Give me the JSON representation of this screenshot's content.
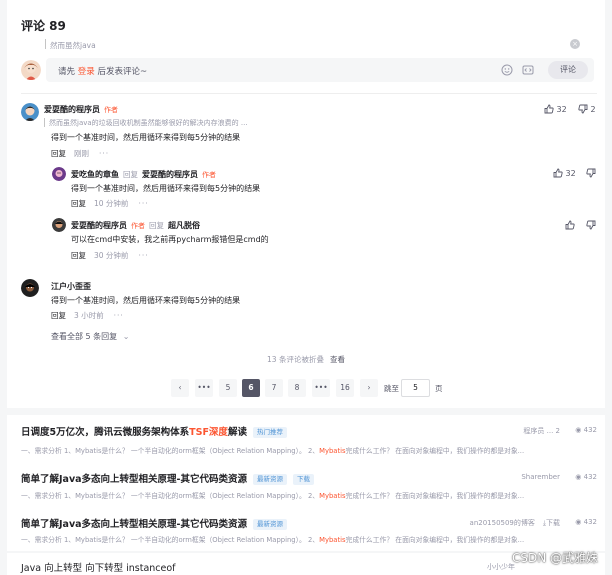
{
  "comments": {
    "title": "评论 89",
    "quote": "然而虽然java",
    "input": {
      "prefix": "请先",
      "login": "登录",
      "suffix": "后发表评论~"
    },
    "submit_label": "评论",
    "list": [
      {
        "name": "爱耍酷的程序员",
        "tag": "作者",
        "quote": "然而虽然java的垃圾回收机制虽然能够很好的解决内存浪费的 ...",
        "text": "得到一个基准时间，然后用循环来得到每5分钟的结果",
        "reply": "回复",
        "time": "刚刚",
        "more": "···",
        "likes": "32",
        "dislikes": "2"
      },
      {
        "name": "爱吃鱼的章鱼",
        "reply_word": "回复",
        "to": "爱耍酷的程序员",
        "to_tag": "作者",
        "text": "得到一个基准时间，然后用循环来得到每5分钟的结果",
        "reply": "回复",
        "time": "10 分钟前",
        "more": "···",
        "likes": "32"
      },
      {
        "name": "爱耍酷的程序员",
        "tag": "作者",
        "reply_word": "回复",
        "to": "超凡脱俗",
        "text": "可以在cmd中安装，我之前再pycharm报错但是cmd的",
        "reply": "回复",
        "time": "30 分钟前",
        "more": "···"
      },
      {
        "name": "江户小歪歪",
        "text": "得到一个基准时间，然后用循环来得到每5分钟的结果",
        "reply": "回复",
        "time": "3 小时前",
        "more": "···"
      }
    ],
    "show_all": "查看全部 5 条回复",
    "folded": "13 条评论被折叠",
    "folded_view": "查看",
    "pagination": {
      "prev": "‹",
      "ellipsis": "•••",
      "pages": [
        "5",
        "6",
        "7",
        "8"
      ],
      "active": "6",
      "last": "16",
      "next": "›",
      "jump_label": "跳至",
      "jump_value": "5",
      "page_unit": "页"
    }
  },
  "recommendations": [
    {
      "title_a": "日调度5万亿次，腾讯云微服务架构体系",
      "title_hl": "TSF深度",
      "title_b": "解读",
      "badge": "热门推荐",
      "source": "程序员 ... 2",
      "views": "432",
      "desc_a": "一、需求分析 1、Mybatis是什么？ 一个半自动化的orm框架（Object Relation Mapping）。 2、",
      "desc_hl": "Mybatis",
      "desc_b": "完成什么工作？ 在面向对象编程中，我们操作的都是对象..."
    },
    {
      "title_a": "简单了解Java多态向上转型相关原理-其它代码类资源",
      "title_hl": "",
      "title_b": "",
      "badge": "最新资源",
      "badge2": "下载",
      "source": "Sharember",
      "views": "432",
      "desc_a": "一、需求分析 1、Mybatis是什么？ 一个半自动化的orm框架（Object Relation Mapping）。 2、",
      "desc_hl": "Mybatis",
      "desc_b": "完成什么工作？ 在面向对象编程中，我们操作的都是对象..."
    },
    {
      "title_a": "简单了解Java多态向上转型相关原理-其它代码类资源",
      "title_hl": "",
      "title_b": "",
      "badge": "最新资源",
      "source": "an20150509的博客",
      "download": "下载",
      "views": "432",
      "desc_a": "一、需求分析 1、Mybatis是什么？ 一个半自动化的orm框架（Object Relation Mapping）。 2、",
      "desc_hl": "Mybatis",
      "desc_b": "完成什么工作？ 在面向对象编程中，我们操作的都是对象..."
    },
    {
      "title_a": "Java 向上转型 向下转型 instanceof",
      "title_hl": "",
      "title_b": "",
      "source": "小小少年",
      "views": ""
    }
  ],
  "watermark": "CSDN @武雅姝"
}
